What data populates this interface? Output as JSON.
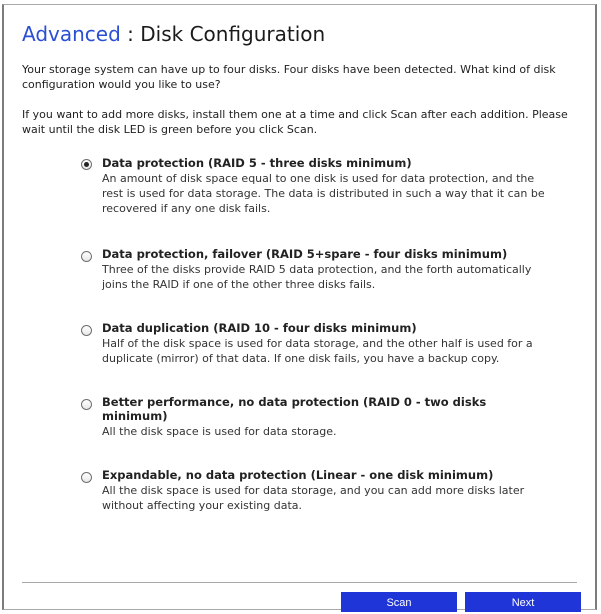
{
  "header": {
    "crumb": "Advanced",
    "separator": ":",
    "title": "Disk Configuration"
  },
  "intro": {
    "p1": "Your storage system can have up to four disks. Four disks have been detected. What kind of disk configuration would you like to use?",
    "p2": "If you want to add more disks, install them one at a time and click Scan after each addition. Please wait until the disk LED is green before you click Scan."
  },
  "options": [
    {
      "label": "Data protection (RAID 5 - three disks minimum)",
      "description": "An amount of disk space equal to one disk is used for data protection, and the rest is used for data storage. The data is distributed in such a way that it can be recovered if any one disk fails.",
      "selected": true
    },
    {
      "label": "Data protection, failover (RAID 5+spare - four disks minimum)",
      "description": "Three of the disks provide RAID 5 data protection, and the forth automatically joins the RAID if one of the other three disks fails.",
      "selected": false
    },
    {
      "label": "Data duplication (RAID 10 - four disks minimum)",
      "description": "Half of the disk space is used for data storage, and the other half is used for a duplicate (mirror) of that data. If one disk fails, you have a backup copy.",
      "selected": false
    },
    {
      "label": "Better performance, no data protection (RAID 0 - two disks minimum)",
      "description": "All the disk space is used for data storage.",
      "selected": false
    },
    {
      "label": "Expandable, no data protection (Linear - one disk minimum)",
      "description": "All the disk space is used for data storage, and you can add more disks later without affecting your existing data.",
      "selected": false
    }
  ],
  "footer": {
    "scan_label": "Scan",
    "next_label": "Next"
  },
  "colors": {
    "crumb": "#2a4fd4",
    "button": "#1f35d8"
  }
}
